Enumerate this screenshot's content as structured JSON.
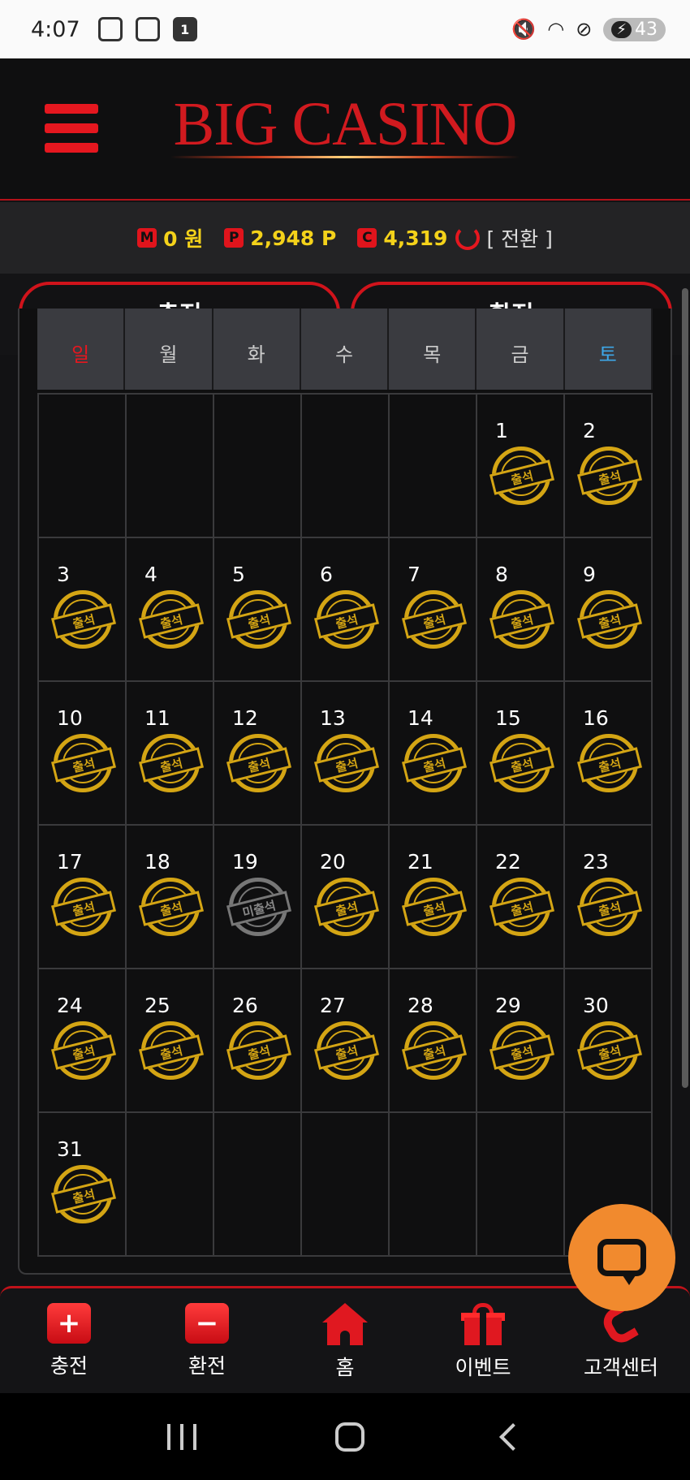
{
  "status_bar": {
    "time": "4:07",
    "notif_badge": "1",
    "battery": "43"
  },
  "header": {
    "logo": "BIG CASINO"
  },
  "balance": {
    "money_badge": "M",
    "money": "0 원",
    "point_badge": "P",
    "points": "2,948 P",
    "coin_badge": "C",
    "coins": "4,319",
    "convert_label": "[ 전환 ]"
  },
  "actions": {
    "charge": "충전",
    "exchange": "환전"
  },
  "calendar": {
    "weekdays": [
      "일",
      "월",
      "화",
      "수",
      "목",
      "금",
      "토"
    ],
    "stamp_attended": "출석",
    "stamp_missed": "미출석",
    "cells": [
      {
        "day": ""
      },
      {
        "day": ""
      },
      {
        "day": ""
      },
      {
        "day": ""
      },
      {
        "day": ""
      },
      {
        "day": "1",
        "status": "attended"
      },
      {
        "day": "2",
        "status": "attended"
      },
      {
        "day": "3",
        "status": "attended"
      },
      {
        "day": "4",
        "status": "attended"
      },
      {
        "day": "5",
        "status": "attended"
      },
      {
        "day": "6",
        "status": "attended"
      },
      {
        "day": "7",
        "status": "attended"
      },
      {
        "day": "8",
        "status": "attended"
      },
      {
        "day": "9",
        "status": "attended"
      },
      {
        "day": "10",
        "status": "attended"
      },
      {
        "day": "11",
        "status": "attended"
      },
      {
        "day": "12",
        "status": "attended"
      },
      {
        "day": "13",
        "status": "attended"
      },
      {
        "day": "14",
        "status": "attended"
      },
      {
        "day": "15",
        "status": "attended"
      },
      {
        "day": "16",
        "status": "attended"
      },
      {
        "day": "17",
        "status": "attended"
      },
      {
        "day": "18",
        "status": "attended"
      },
      {
        "day": "19",
        "status": "missed"
      },
      {
        "day": "20",
        "status": "attended"
      },
      {
        "day": "21",
        "status": "attended"
      },
      {
        "day": "22",
        "status": "attended"
      },
      {
        "day": "23",
        "status": "attended"
      },
      {
        "day": "24",
        "status": "attended"
      },
      {
        "day": "25",
        "status": "attended"
      },
      {
        "day": "26",
        "status": "attended"
      },
      {
        "day": "27",
        "status": "attended"
      },
      {
        "day": "28",
        "status": "attended"
      },
      {
        "day": "29",
        "status": "attended"
      },
      {
        "day": "30",
        "status": "attended"
      },
      {
        "day": "31",
        "status": "attended"
      },
      {
        "day": ""
      },
      {
        "day": ""
      },
      {
        "day": ""
      },
      {
        "day": ""
      },
      {
        "day": ""
      },
      {
        "day": ""
      }
    ]
  },
  "bottom_nav": {
    "items": [
      {
        "label": "충전",
        "icon": "plus-icon"
      },
      {
        "label": "환전",
        "icon": "minus-icon"
      },
      {
        "label": "홈",
        "icon": "home-icon"
      },
      {
        "label": "이벤트",
        "icon": "gift-icon"
      },
      {
        "label": "고객센터",
        "icon": "phone-icon"
      }
    ]
  },
  "colors": {
    "accent_red": "#e5171f",
    "gold": "#d4a514",
    "value_yellow": "#f4d21a",
    "chat_orange": "#f18a2e"
  }
}
